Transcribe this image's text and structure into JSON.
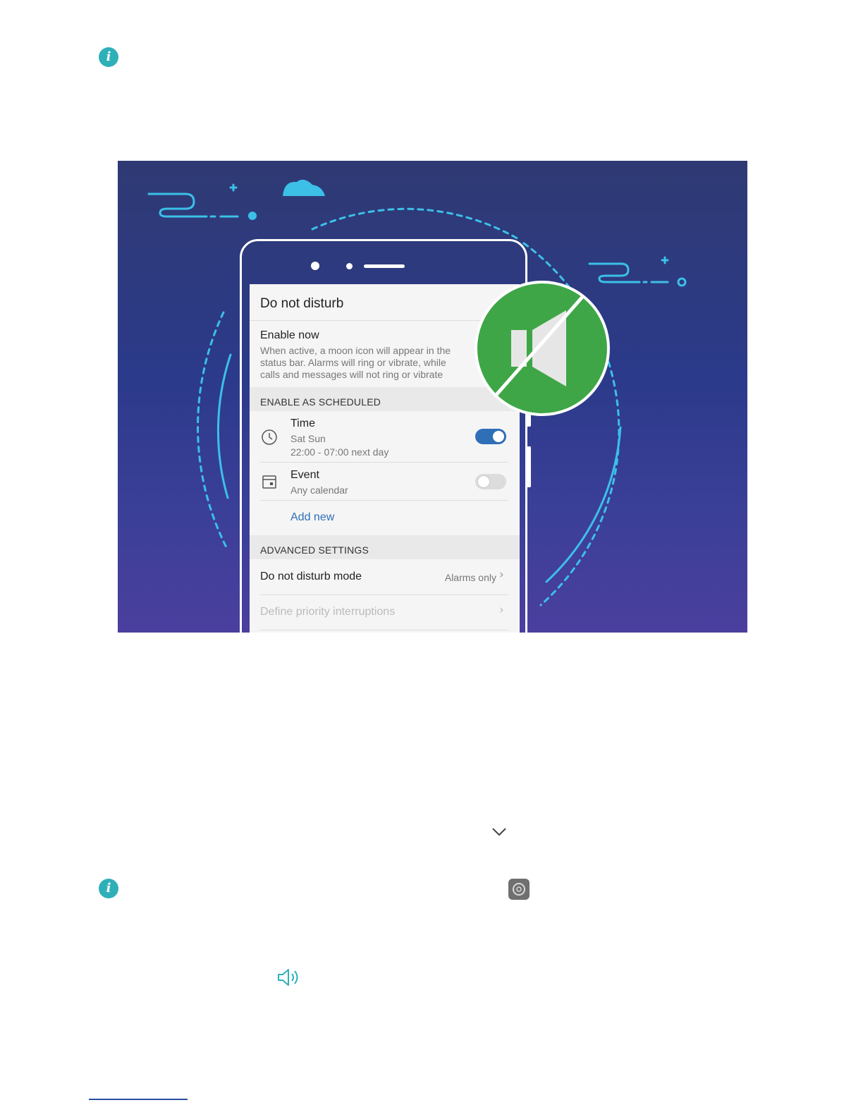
{
  "screen": {
    "title": "Do not disturb",
    "enable_now": {
      "label": "Enable now",
      "description_lines": [
        "When active, a moon icon will appear in the",
        "status bar. Alarms will ring or vibrate, while",
        "calls and messages will not ring or vibrate"
      ]
    },
    "scheduled_header": "ENABLE AS SCHEDULED",
    "time_rule": {
      "label": "Time",
      "days": "Sat Sun",
      "hours": "22:00 - 07:00 next day",
      "enabled": true
    },
    "event_rule": {
      "label": "Event",
      "calendar": "Any calendar",
      "enabled": false
    },
    "add_new": "Add new",
    "advanced_header": "ADVANCED SETTINGS",
    "dnd_mode": {
      "label": "Do not disturb mode",
      "value": "Alarms only"
    },
    "priority": "Define priority interruptions"
  },
  "colors": {
    "accent_blue": "#2f6fb7",
    "teal": "#2fb0b8",
    "badge_green": "#3ea646",
    "illustration_cyan": "#3cc0e8"
  },
  "icons": [
    "info-icon",
    "clock-icon",
    "calendar-icon",
    "mute-speaker-icon",
    "chevron-down-icon",
    "settings-app-icon",
    "volume-icon"
  ]
}
